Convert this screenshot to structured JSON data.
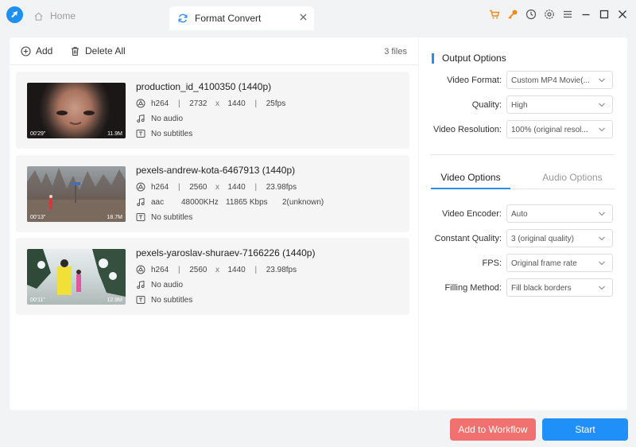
{
  "colors": {
    "accent": "#1e90f8",
    "workflow": "#f07170",
    "logo": "#1f8ff0"
  },
  "titlebar": {
    "home_label": "Home",
    "active_tab_label": "Format Convert",
    "icons": [
      "cart-icon",
      "key-icon",
      "clock-icon",
      "settings-icon",
      "menu-icon",
      "minimize-icon",
      "maximize-icon",
      "close-icon"
    ]
  },
  "toolbar": {
    "add_label": "Add",
    "delete_all_label": "Delete All",
    "file_count": "3 files"
  },
  "files": [
    {
      "name": "production_id_4100350 (1440p)",
      "duration": "00'29\"",
      "size": "11.9M",
      "codec": "h264",
      "width": "2732",
      "x": "x",
      "height": "1440",
      "fps": "25fps",
      "audio": "No audio",
      "subtitles": "No subtitles"
    },
    {
      "name": "pexels-andrew-kota-6467913 (1440p)",
      "duration": "00'13\"",
      "size": "18.7M",
      "codec": "h264",
      "width": "2560",
      "x": "x",
      "height": "1440",
      "fps": "23.98fps",
      "audio_codec": "aac",
      "audio_rate": "48000KHz",
      "audio_bitrate": "11865 Kbps",
      "audio_channels": "2(unknown)",
      "subtitles": "No subtitles"
    },
    {
      "name": "pexels-yaroslav-shuraev-7166226 (1440p)",
      "duration": "00'11\"",
      "size": "12.9M",
      "codec": "h264",
      "width": "2560",
      "x": "x",
      "height": "1440",
      "fps": "23.98fps",
      "audio": "No audio",
      "subtitles": "No subtitles"
    }
  ],
  "output": {
    "title": "Output Options",
    "video_format": {
      "label": "Video Format:",
      "value": "Custom MP4 Movie(..."
    },
    "quality": {
      "label": "Quality:",
      "value": "High"
    },
    "resolution": {
      "label": "Video Resolution:",
      "value": "100% (original resol..."
    }
  },
  "tabs": {
    "video": "Video Options",
    "audio": "Audio Options",
    "selected": "Video Options"
  },
  "video_options": {
    "encoder": {
      "label": "Video Encoder:",
      "value": "Auto"
    },
    "constant_quality": {
      "label": "Constant Quality:",
      "value": "3 (original quality)"
    },
    "fps": {
      "label": "FPS:",
      "value": "Original frame rate"
    },
    "filling": {
      "label": "Filling Method:",
      "value": "Fill black borders"
    }
  },
  "buttons": {
    "workflow": "Add to Workflow",
    "start": "Start"
  }
}
